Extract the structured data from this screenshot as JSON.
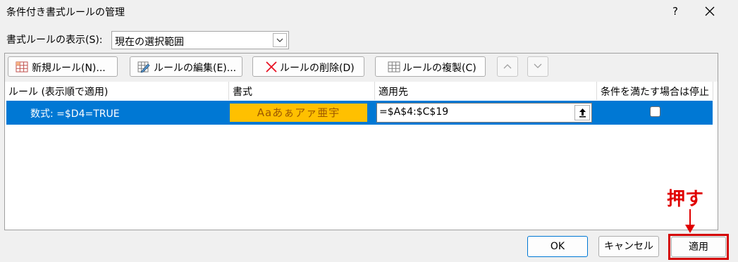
{
  "window": {
    "title": "条件付き書式ルールの管理",
    "help_label": "?"
  },
  "show_rules": {
    "label": "書式ルールの表示(S):",
    "selected": "現在の選択範囲"
  },
  "toolbar": {
    "new_rule": "新規ルール(N)...",
    "edit_rule": "ルールの編集(E)...",
    "delete_rule": "ルールの削除(D)",
    "duplicate_rule": "ルールの複製(C)"
  },
  "table": {
    "headers": [
      "ルール (表示順で適用)",
      "書式",
      "適用先",
      "条件を満たす場合は停止"
    ],
    "rows": [
      {
        "rule": "数式: =$D4=TRUE",
        "format_preview": "Aaあぁアァ亜宇",
        "applies_to": "=$A$4:$C$19",
        "stop_if_true": false
      }
    ]
  },
  "annotation": {
    "text": "押す"
  },
  "buttons": {
    "ok": "OK",
    "cancel": "キャンセル",
    "apply": "適用"
  },
  "colors": {
    "selection": "#0078d4",
    "format_fill": "#ffc000",
    "format_text": "#9c5700",
    "annotation": "#e00000"
  }
}
